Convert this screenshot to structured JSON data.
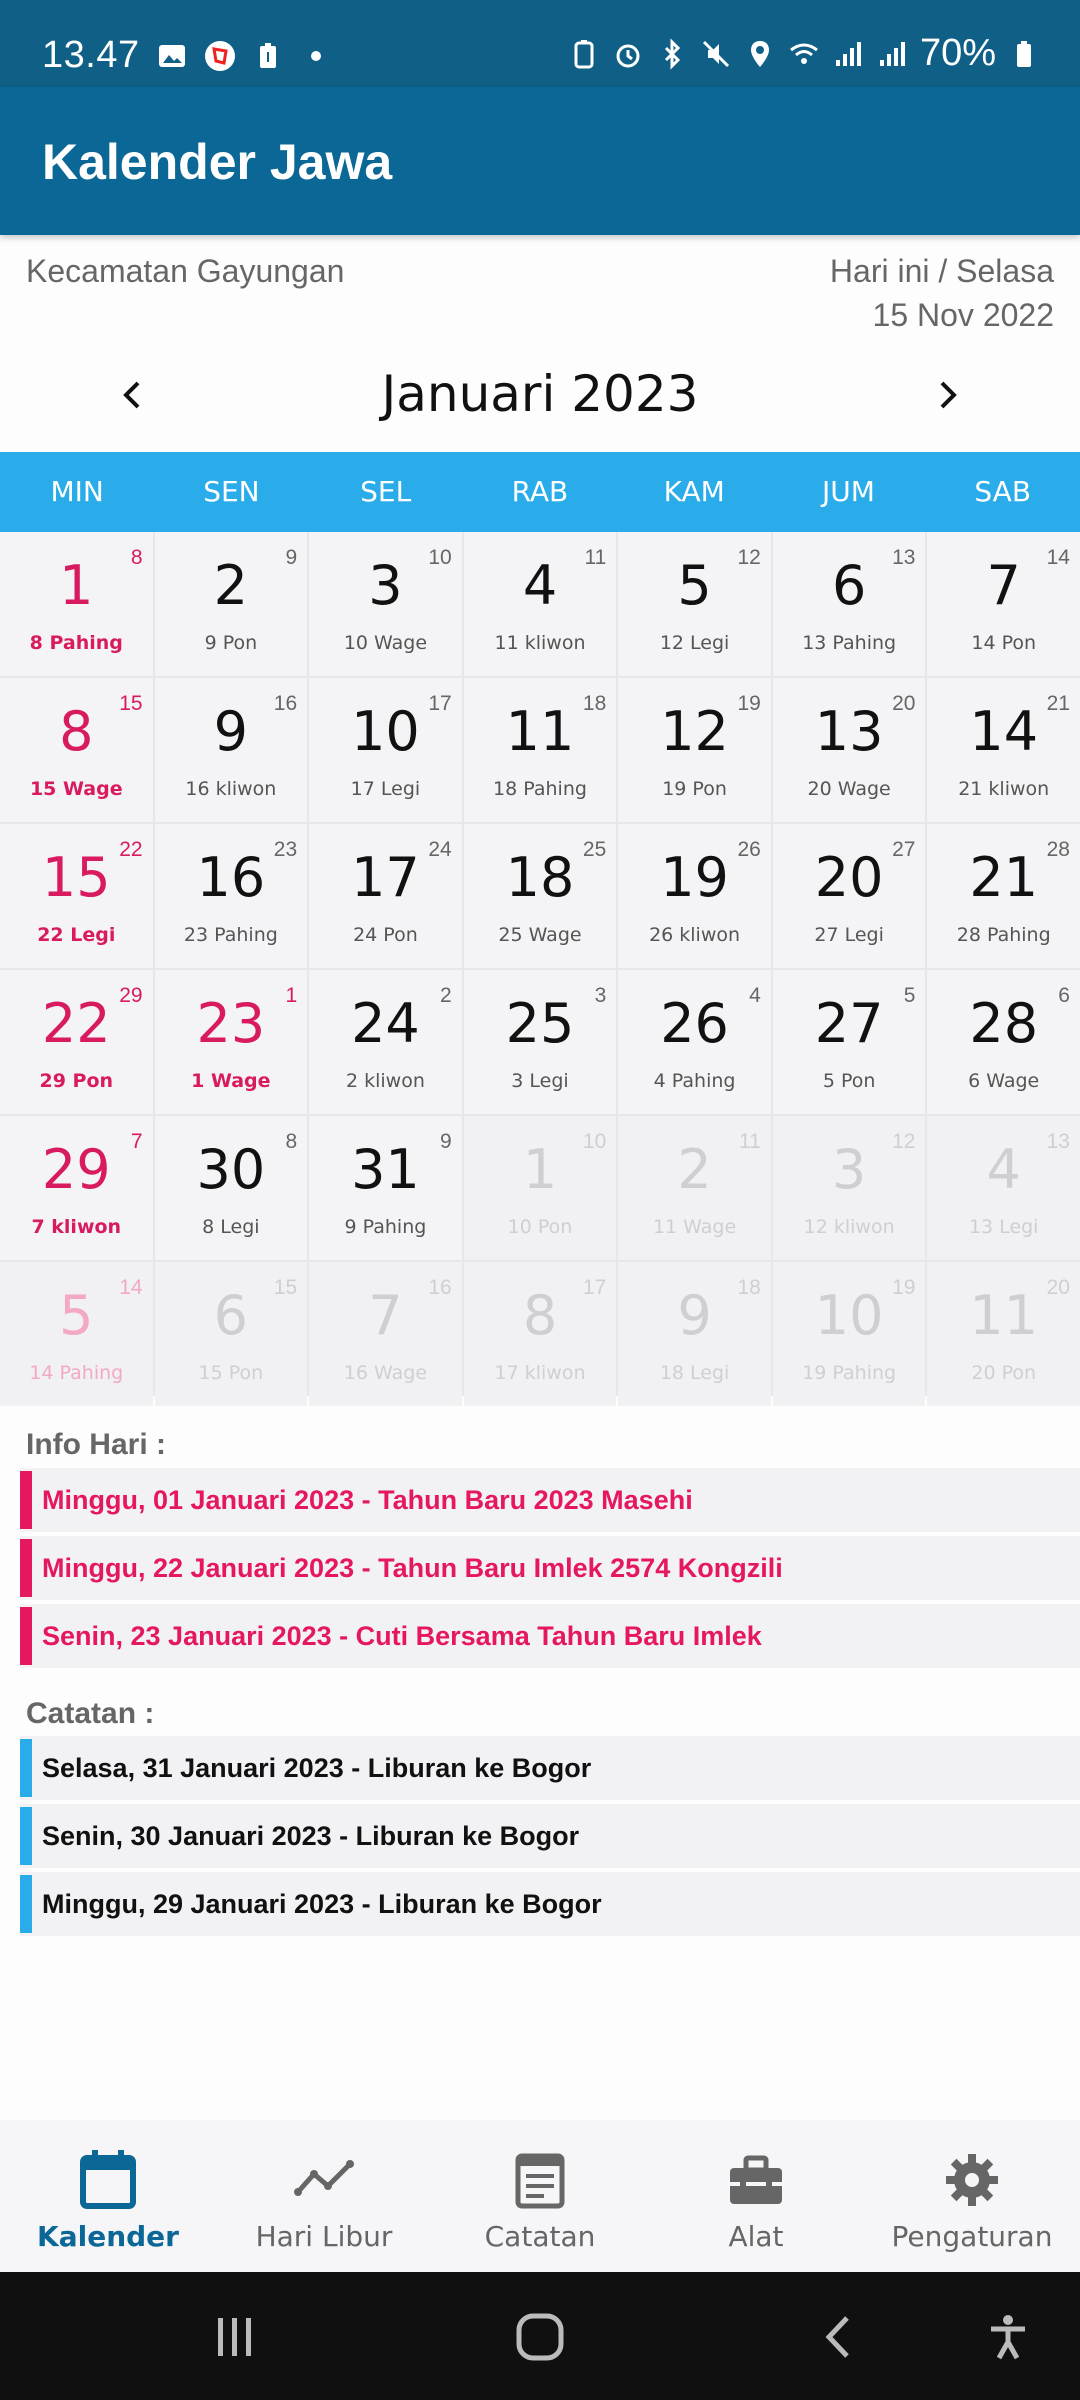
{
  "status": {
    "time": "13.47",
    "battery": "70%"
  },
  "app": {
    "title": "Kalender Jawa"
  },
  "header": {
    "location": "Kecamatan Gayungan",
    "today_label": "Hari ini / Selasa",
    "today_date": "15 Nov 2022"
  },
  "calendar": {
    "month_title": "Januari  2023",
    "weekdays": [
      "MIN",
      "SEN",
      "SEL",
      "RAB",
      "KAM",
      "JUM",
      "SAB"
    ],
    "cells": [
      {
        "day": "1",
        "hijri": "8",
        "pasaran": "8 Pahing",
        "style": "red"
      },
      {
        "day": "2",
        "hijri": "9",
        "pasaran": "9 Pon",
        "style": "normal"
      },
      {
        "day": "3",
        "hijri": "10",
        "pasaran": "10 Wage",
        "style": "normal"
      },
      {
        "day": "4",
        "hijri": "11",
        "pasaran": "11 kliwon",
        "style": "normal"
      },
      {
        "day": "5",
        "hijri": "12",
        "pasaran": "12 Legi",
        "style": "normal"
      },
      {
        "day": "6",
        "hijri": "13",
        "pasaran": "13 Pahing",
        "style": "normal"
      },
      {
        "day": "7",
        "hijri": "14",
        "pasaran": "14 Pon",
        "style": "normal"
      },
      {
        "day": "8",
        "hijri": "15",
        "pasaran": "15 Wage",
        "style": "red"
      },
      {
        "day": "9",
        "hijri": "16",
        "pasaran": "16 kliwon",
        "style": "normal"
      },
      {
        "day": "10",
        "hijri": "17",
        "pasaran": "17 Legi",
        "style": "normal"
      },
      {
        "day": "11",
        "hijri": "18",
        "pasaran": "18 Pahing",
        "style": "normal"
      },
      {
        "day": "12",
        "hijri": "19",
        "pasaran": "19 Pon",
        "style": "normal"
      },
      {
        "day": "13",
        "hijri": "20",
        "pasaran": "20 Wage",
        "style": "normal"
      },
      {
        "day": "14",
        "hijri": "21",
        "pasaran": "21 kliwon",
        "style": "normal"
      },
      {
        "day": "15",
        "hijri": "22",
        "pasaran": "22 Legi",
        "style": "red"
      },
      {
        "day": "16",
        "hijri": "23",
        "pasaran": "23 Pahing",
        "style": "normal"
      },
      {
        "day": "17",
        "hijri": "24",
        "pasaran": "24 Pon",
        "style": "normal"
      },
      {
        "day": "18",
        "hijri": "25",
        "pasaran": "25 Wage",
        "style": "normal"
      },
      {
        "day": "19",
        "hijri": "26",
        "pasaran": "26 kliwon",
        "style": "normal"
      },
      {
        "day": "20",
        "hijri": "27",
        "pasaran": "27 Legi",
        "style": "normal"
      },
      {
        "day": "21",
        "hijri": "28",
        "pasaran": "28 Pahing",
        "style": "normal"
      },
      {
        "day": "22",
        "hijri": "29",
        "pasaran": "29 Pon",
        "style": "red"
      },
      {
        "day": "23",
        "hijri": "1",
        "pasaran": "1 Wage",
        "style": "red"
      },
      {
        "day": "24",
        "hijri": "2",
        "pasaran": "2 kliwon",
        "style": "normal"
      },
      {
        "day": "25",
        "hijri": "3",
        "pasaran": "3 Legi",
        "style": "normal"
      },
      {
        "day": "26",
        "hijri": "4",
        "pasaran": "4 Pahing",
        "style": "normal"
      },
      {
        "day": "27",
        "hijri": "5",
        "pasaran": "5 Pon",
        "style": "normal"
      },
      {
        "day": "28",
        "hijri": "6",
        "pasaran": "6 Wage",
        "style": "normal"
      },
      {
        "day": "29",
        "hijri": "7",
        "pasaran": "7 kliwon",
        "style": "red"
      },
      {
        "day": "30",
        "hijri": "8",
        "pasaran": "8 Legi",
        "style": "normal"
      },
      {
        "day": "31",
        "hijri": "9",
        "pasaran": "9 Pahing",
        "style": "normal"
      },
      {
        "day": "1",
        "hijri": "10",
        "pasaran": "10 Pon",
        "style": "faint"
      },
      {
        "day": "2",
        "hijri": "11",
        "pasaran": "11 Wage",
        "style": "faint"
      },
      {
        "day": "3",
        "hijri": "12",
        "pasaran": "12 kliwon",
        "style": "faint"
      },
      {
        "day": "4",
        "hijri": "13",
        "pasaran": "13 Legi",
        "style": "faint"
      },
      {
        "day": "5",
        "hijri": "14",
        "pasaran": "14 Pahing",
        "style": "faintred"
      },
      {
        "day": "6",
        "hijri": "15",
        "pasaran": "15 Pon",
        "style": "faint"
      },
      {
        "day": "7",
        "hijri": "16",
        "pasaran": "16 Wage",
        "style": "faint"
      },
      {
        "day": "8",
        "hijri": "17",
        "pasaran": "17 kliwon",
        "style": "faint"
      },
      {
        "day": "9",
        "hijri": "18",
        "pasaran": "18 Legi",
        "style": "faint"
      },
      {
        "day": "10",
        "hijri": "19",
        "pasaran": "19 Pahing",
        "style": "faint"
      },
      {
        "day": "11",
        "hijri": "20",
        "pasaran": "20 Pon",
        "style": "faint"
      }
    ]
  },
  "info": {
    "title": "Info Hari :",
    "color": "#e5175f",
    "items": [
      "Minggu, 01 Januari 2023  -  Tahun Baru 2023 Masehi",
      "Minggu, 22 Januari 2023  -  Tahun Baru Imlek 2574 Kongzili",
      "Senin, 23 Januari 2023  -  Cuti Bersama Tahun Baru Imlek"
    ]
  },
  "notes": {
    "title": "Catatan :",
    "color": "#2aacea",
    "items": [
      "Selasa, 31 Januari 2023  -  Liburan ke Bogor",
      "Senin, 30 Januari 2023  -  Liburan ke Bogor",
      "Minggu, 29 Januari 2023  -  Liburan ke Bogor"
    ]
  },
  "bottom_nav": {
    "tabs": [
      {
        "label": "Kalender",
        "icon": "calendar-icon"
      },
      {
        "label": "Hari Libur",
        "icon": "trend-icon"
      },
      {
        "label": "Catatan",
        "icon": "notes-icon"
      },
      {
        "label": "Alat",
        "icon": "toolbox-icon"
      },
      {
        "label": "Pengaturan",
        "icon": "gear-icon"
      }
    ],
    "active_color": "#0a6796"
  }
}
